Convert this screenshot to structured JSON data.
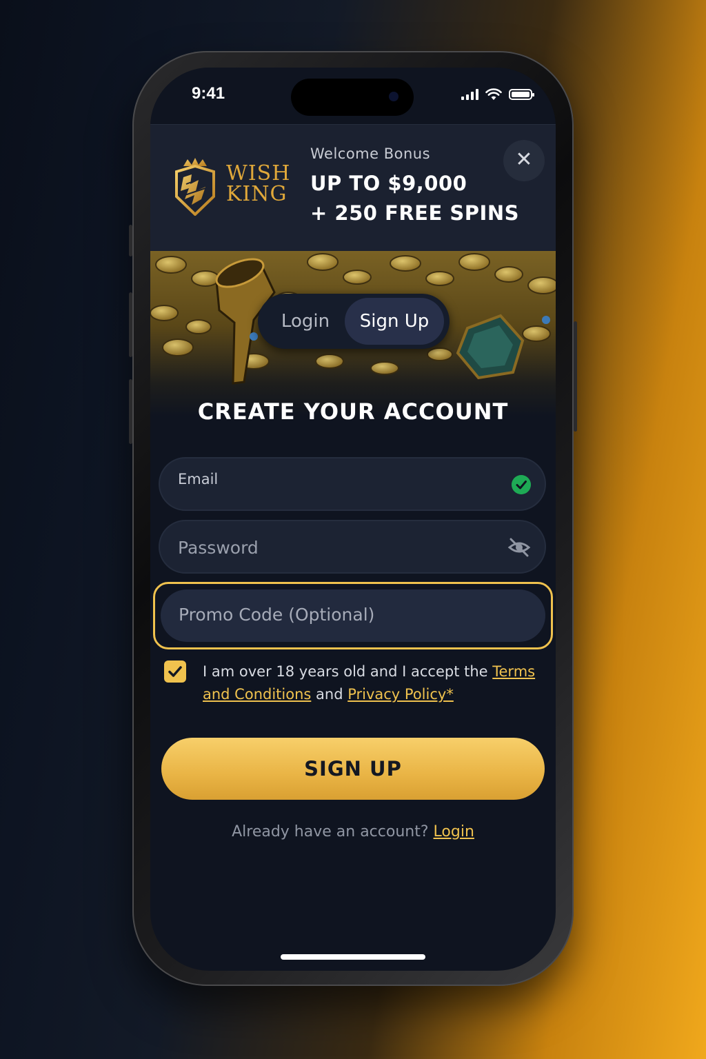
{
  "status_bar": {
    "time": "9:41"
  },
  "brand": {
    "line1": "WISH",
    "line2": "KING"
  },
  "banner": {
    "small_label": "Welcome Bonus",
    "line1": "UP TO $9,000",
    "line2": "+ 250 FREE SPINS",
    "close_glyph": "✕"
  },
  "tabs": {
    "login": "Login",
    "signup": "Sign Up",
    "active": "Sign Up"
  },
  "form": {
    "heading": "CREATE YOUR ACCOUNT",
    "email_label": "Email",
    "password_placeholder": "Password",
    "promo_placeholder": "Promo Code (Optional)",
    "terms": {
      "checked": true,
      "prefix": "I am over 18 years old and I accept the ",
      "terms_link": "Terms and Conditions",
      "middle": " and ",
      "privacy_link": "Privacy Policy*"
    },
    "submit_label": "SIGN UP",
    "footer_text": "Already have an account? ",
    "footer_link": "Login"
  },
  "colors": {
    "accent": "#f0c24e",
    "success": "#1eaa55",
    "panel": "#1b2130",
    "screen_bg": "#0f1420"
  },
  "icons": [
    "close-icon",
    "check-circle-icon",
    "eye-off-icon",
    "checkbox-check-icon",
    "signal-icon",
    "wifi-icon",
    "battery-icon"
  ]
}
